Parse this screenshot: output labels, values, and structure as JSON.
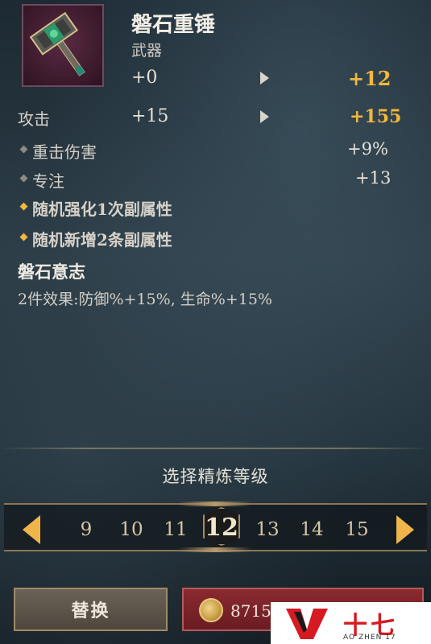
{
  "item": {
    "name": "磐石重锤",
    "type": "武器",
    "icon": "hammer-icon",
    "refine_current": "+0",
    "refine_next": "+12"
  },
  "attack": {
    "label": "攻击",
    "current": "+15",
    "next": "+155"
  },
  "substats": [
    {
      "label": "重击伤害",
      "value": "+9%"
    },
    {
      "label": "专注",
      "value": "+13"
    }
  ],
  "bonuses": [
    {
      "label": "随机强化1次副属性"
    },
    {
      "label": "随机新增2条副属性"
    }
  ],
  "set": {
    "title": "磐石意志",
    "desc": "2件效果:防御%+15%, 生命%+15%"
  },
  "refine": {
    "title": "选择精炼等级",
    "levels": [
      "9",
      "10",
      "11",
      "12",
      "13",
      "14",
      "15"
    ],
    "selected": "12"
  },
  "buttons": {
    "replace": "替换",
    "cost": "8715"
  },
  "watermark": {
    "big": "十七",
    "small": "AO ZHEN 17"
  },
  "colors": {
    "accent_gold": "#f3b83c",
    "button_red": "#8a2a30"
  }
}
